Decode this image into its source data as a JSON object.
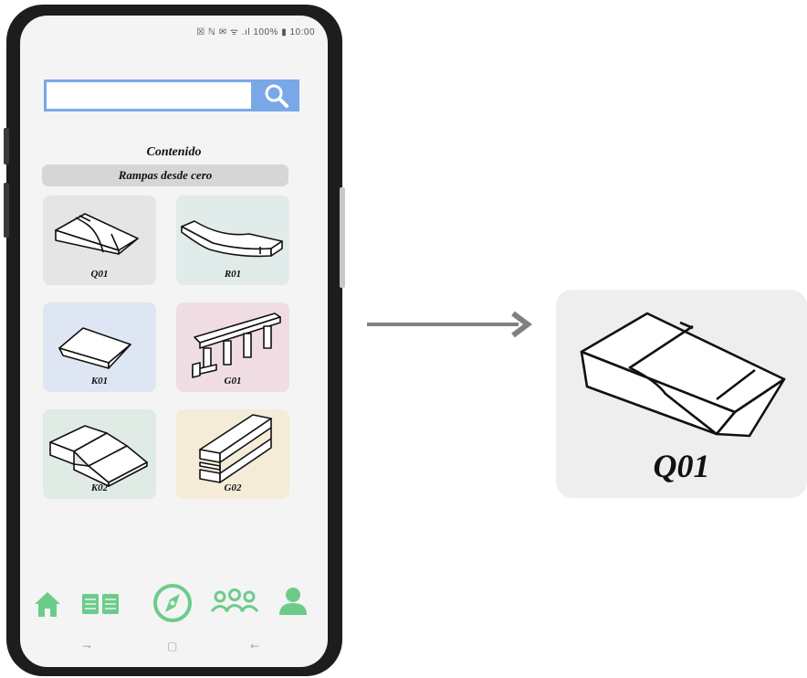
{
  "status_bar": {
    "text": "☒ ℕ ✉ ᯤ .ıl 100% ▮ 10:00"
  },
  "search": {
    "value": "",
    "placeholder": "",
    "button_icon": "search-icon"
  },
  "section": {
    "title": "Contenido",
    "subtitle": "Rampas desde cero"
  },
  "cards": [
    {
      "label": "Q01",
      "bg": "#e4e5e4",
      "icon": "quarter-pipe-ramp-icon"
    },
    {
      "label": "R01",
      "bg": "#e1ebea",
      "icon": "rail-ramp-icon"
    },
    {
      "label": "K01",
      "bg": "#dfe6f3",
      "icon": "kicker-ramp-icon"
    },
    {
      "label": "G01",
      "bg": "#f0dde3",
      "icon": "grind-rail-icon"
    },
    {
      "label": "K02",
      "bg": "#e1ebe5",
      "icon": "kicker-box-icon"
    },
    {
      "label": "G02",
      "bg": "#f4ecd7",
      "icon": "grind-box-icon"
    }
  ],
  "nav": {
    "accent": "#6dcb8a",
    "items": [
      "home-icon",
      "book-icon",
      "compass-icon",
      "group-icon",
      "profile-icon"
    ]
  },
  "system_nav": {
    "recent": "⇁",
    "home": "▢",
    "back": "←"
  },
  "zoom": {
    "label": "Q01",
    "icon": "quarter-pipe-ramp-icon"
  },
  "arrow_color": "#808080"
}
